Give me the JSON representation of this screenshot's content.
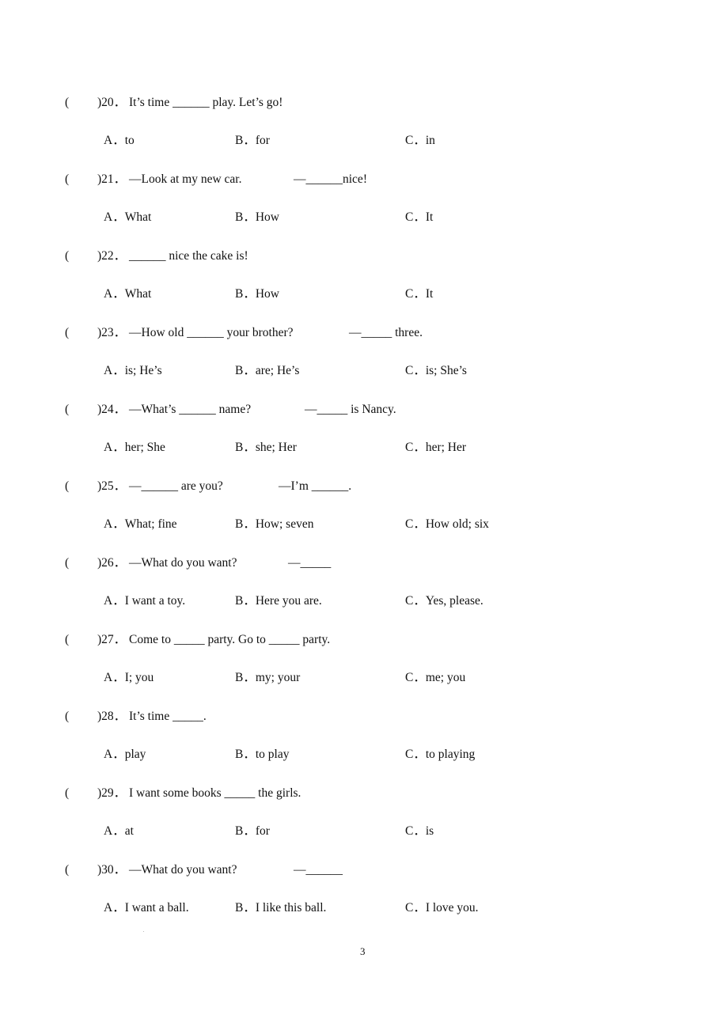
{
  "questions": [
    {
      "paren": "(",
      "number": ")20．",
      "stem": "It’s time ______ play. Let’s go!",
      "reply": "",
      "options": [
        "A．to",
        "B．for",
        "C．in"
      ]
    },
    {
      "paren": "(",
      "number": ")21．",
      "stem": "—Look at my new car.",
      "reply": "—______nice!",
      "options": [
        "A．What",
        "B．How",
        "C．It"
      ]
    },
    {
      "paren": "(",
      "number": ")22．",
      "stem": "______ nice the cake is!",
      "reply": "",
      "options": [
        "A．What",
        "B．How",
        "C．It"
      ]
    },
    {
      "paren": "(",
      "number": ")23．",
      "stem": "—How old ______ your brother?",
      "reply": "—_____ three.",
      "options": [
        "A．is; He’s",
        "B．are; He’s",
        "C．is; She’s"
      ]
    },
    {
      "paren": "(",
      "number": ")24．",
      "stem": "—What’s ______ name?",
      "reply": "—_____ is Nancy.",
      "options": [
        "A．her; She",
        "B．she; Her",
        "C．her; Her"
      ]
    },
    {
      "paren": "(",
      "number": ")25．",
      "stem": "—______ are you?",
      "reply": "—I’m ______.",
      "options": [
        "A．What; fine",
        "B．How; seven",
        "C．How old; six"
      ]
    },
    {
      "paren": "(",
      "number": ")26．",
      "stem": "—What do you want?",
      "reply": "—_____",
      "options": [
        "A．I want a toy.",
        "B．Here you are.",
        "C．Yes, please."
      ]
    },
    {
      "paren": "(",
      "number": ")27．",
      "stem": "Come to _____ party. Go to _____ party.",
      "reply": "",
      "options": [
        "A．I; you",
        "B．my; your",
        "C．me; you"
      ]
    },
    {
      "paren": "(",
      "number": ")28．",
      "stem": "It’s time _____.",
      "reply": "",
      "options": [
        "A．play",
        "B．to play",
        "C．to playing"
      ]
    },
    {
      "paren": "(",
      "number": ")29．",
      "stem": "I want some books _____ the girls.",
      "reply": "",
      "options": [
        "A．at",
        "B．for",
        "C．is"
      ]
    },
    {
      "paren": "(",
      "number": ")30．",
      "stem": "—What do you want?",
      "reply": "—______",
      "options": [
        "A．I want a ball.",
        "B．I like this ball.",
        "C．I love you."
      ]
    }
  ],
  "page_number": "3"
}
